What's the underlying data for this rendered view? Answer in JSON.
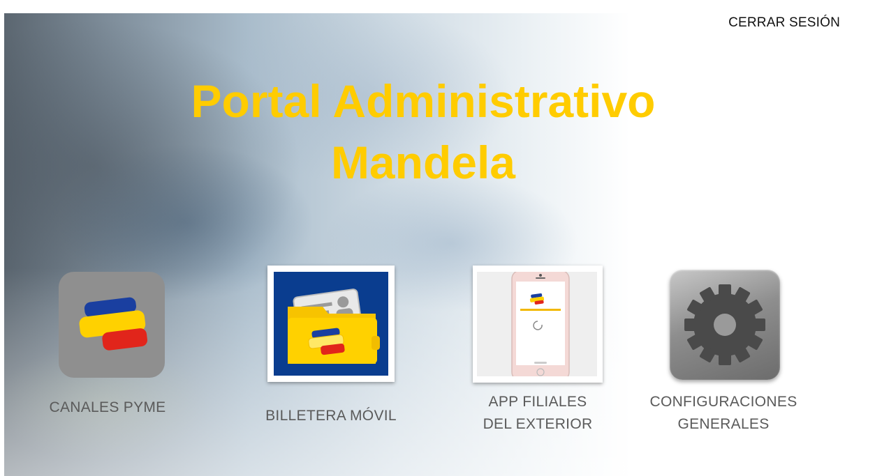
{
  "header": {
    "logout_label": "CERRAR SESIÓN"
  },
  "page": {
    "title_line1": "Portal Administrativo",
    "title_line2": "Mandela"
  },
  "tiles": [
    {
      "label_line1": "CANALES PYME",
      "label_line2": "",
      "icon": "bank-flag-logo-icon"
    },
    {
      "label_line1": "BILLETERA MÓVIL",
      "label_line2": "",
      "icon": "wallet-folder-icon"
    },
    {
      "label_line1": "APP FILIALES",
      "label_line2": "DEL EXTERIOR",
      "icon": "phone-app-icon"
    },
    {
      "label_line1": "CONFIGURACIONES",
      "label_line2": "GENERALES",
      "icon": "gear-icon"
    }
  ],
  "colors": {
    "title": "#FFCC00",
    "flag_blue": "#1a3fa0",
    "flag_yellow": "#FFD100",
    "flag_red": "#E1251B",
    "wallet_bg": "#0a3d8f"
  }
}
